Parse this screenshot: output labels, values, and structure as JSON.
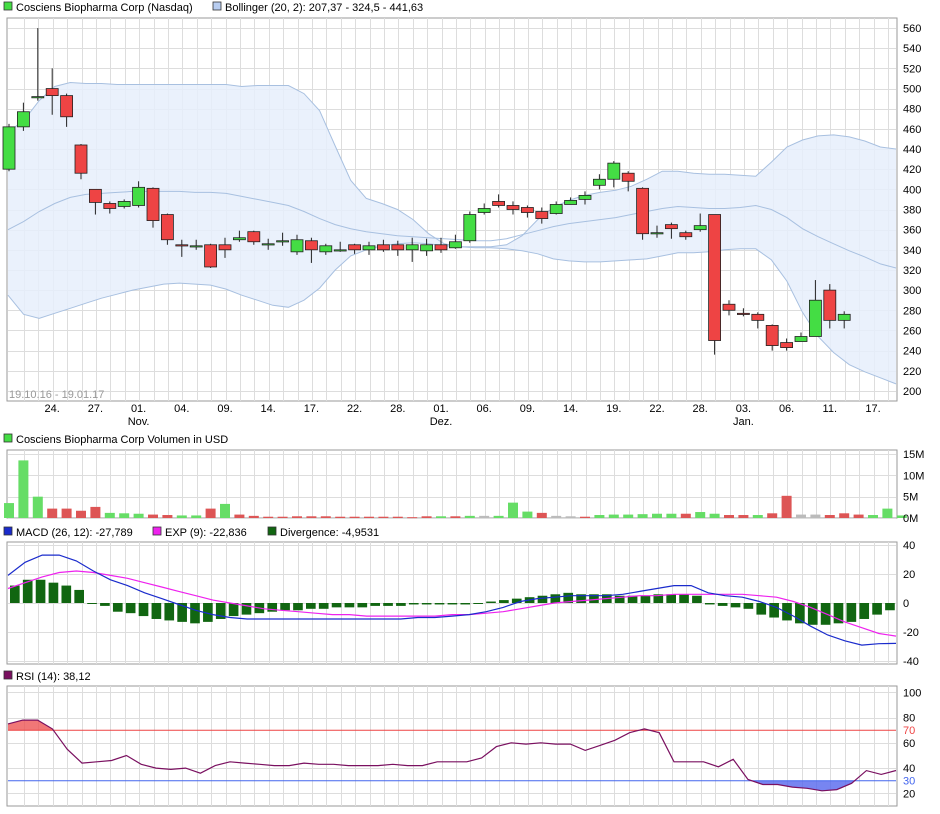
{
  "colors": {
    "up": "#44dd44",
    "down": "#ee4444",
    "band_fill": "#e6eefb",
    "band_line": "#a8c0e0",
    "grid": "#dddddd",
    "macd": "#1a2bcc",
    "signal": "#ee22ee",
    "divergence": "#116611",
    "rsi": "#7a1060",
    "rsi_upper": "#ee4444",
    "rsi_lower": "#4466ee"
  },
  "chart_data": [
    {
      "type": "candlestick",
      "legend": [
        {
          "label": "Cosciens Biopharma Corp (Nasdaq)",
          "swatch": "up"
        },
        {
          "label": "Bollinger (20, 2): 207,37 - 324,5 - 441,63",
          "swatch": "band"
        }
      ],
      "date_range_label": "19.10.16 - 19.01.17",
      "ylim": [
        190,
        570
      ],
      "yticks": [
        200,
        220,
        240,
        260,
        280,
        300,
        320,
        340,
        360,
        380,
        400,
        420,
        440,
        460,
        480,
        500,
        520,
        540,
        560
      ],
      "x_ticks": [
        {
          "i": 3,
          "label": "24."
        },
        {
          "i": 6,
          "label": "27."
        },
        {
          "i": 9,
          "label": "01.",
          "sub": "Nov."
        },
        {
          "i": 12,
          "label": "04."
        },
        {
          "i": 15,
          "label": "09."
        },
        {
          "i": 18,
          "label": "14."
        },
        {
          "i": 21,
          "label": "17."
        },
        {
          "i": 24,
          "label": "22."
        },
        {
          "i": 27,
          "label": "28."
        },
        {
          "i": 30,
          "label": "01.",
          "sub": "Dez."
        },
        {
          "i": 33,
          "label": "06."
        },
        {
          "i": 36,
          "label": "09."
        },
        {
          "i": 39,
          "label": "14."
        },
        {
          "i": 42,
          "label": "19."
        },
        {
          "i": 45,
          "label": "22."
        },
        {
          "i": 48,
          "label": "28."
        },
        {
          "i": 51,
          "label": "03.",
          "sub": "Jan."
        },
        {
          "i": 54,
          "label": "06."
        },
        {
          "i": 57,
          "label": "11."
        },
        {
          "i": 60,
          "label": "17."
        }
      ],
      "candles": [
        [
          420,
          462,
          418,
          465
        ],
        [
          462,
          477,
          458,
          486
        ],
        [
          491,
          492,
          488,
          560
        ],
        [
          500,
          493,
          474,
          520
        ],
        [
          493,
          472,
          462,
          495
        ],
        [
          444,
          416,
          410,
          445
        ],
        [
          400,
          387,
          375,
          400
        ],
        [
          386,
          381,
          376,
          388
        ],
        [
          383,
          388,
          381,
          390
        ],
        [
          384,
          402,
          382,
          408
        ],
        [
          401,
          369,
          362,
          402
        ],
        [
          375,
          350,
          345,
          376
        ],
        [
          345,
          344,
          333,
          350
        ],
        [
          343,
          344,
          340,
          350
        ],
        [
          345,
          323,
          322,
          346
        ],
        [
          345,
          340,
          332,
          352
        ],
        [
          350,
          352,
          348,
          359
        ],
        [
          358,
          348,
          345,
          359
        ],
        [
          345,
          346,
          340,
          351
        ],
        [
          349,
          349,
          344,
          357
        ],
        [
          338,
          350,
          335,
          355
        ],
        [
          349,
          340,
          327,
          352
        ],
        [
          338,
          344,
          335,
          346
        ],
        [
          340,
          340,
          338,
          348
        ],
        [
          345,
          340,
          336,
          346
        ],
        [
          340,
          344,
          335,
          348
        ],
        [
          345,
          340,
          338,
          350
        ],
        [
          345,
          340,
          334,
          349
        ],
        [
          340,
          345,
          328,
          352
        ],
        [
          339,
          345,
          334,
          351
        ],
        [
          345,
          340,
          337,
          352
        ],
        [
          342,
          348,
          341,
          355
        ],
        [
          349,
          375,
          347,
          378
        ],
        [
          377,
          381,
          375,
          386
        ],
        [
          388,
          384,
          382,
          395
        ],
        [
          384,
          380,
          375,
          388
        ],
        [
          382,
          377,
          372,
          384
        ],
        [
          378,
          371,
          366,
          382
        ],
        [
          376,
          385,
          375,
          388
        ],
        [
          385,
          389,
          385,
          392
        ],
        [
          390,
          394,
          385,
          398
        ],
        [
          404,
          410,
          400,
          415
        ],
        [
          410,
          426,
          402,
          428
        ],
        [
          416,
          408,
          398,
          418
        ],
        [
          401,
          356,
          350,
          402
        ],
        [
          357,
          357,
          352,
          364
        ],
        [
          365,
          361,
          351,
          367
        ],
        [
          357,
          353,
          350,
          359
        ],
        [
          360,
          364,
          358,
          376
        ],
        [
          375,
          250,
          236,
          308
        ],
        [
          286,
          280,
          275,
          290
        ],
        [
          277,
          276,
          274,
          282
        ],
        [
          276,
          270,
          262,
          278
        ],
        [
          265,
          245,
          240,
          266
        ],
        [
          248,
          243,
          240,
          252
        ],
        [
          249,
          254,
          249,
          258
        ],
        [
          254,
          290,
          254,
          310
        ],
        [
          300,
          270,
          262,
          306
        ],
        [
          270,
          276,
          262,
          279
        ]
      ],
      "bollinger": {
        "upper": [
          457,
          468,
          488,
          502,
          506,
          505,
          505,
          504,
          504,
          504,
          504,
          504,
          504,
          504,
          504,
          502,
          503,
          503,
          503,
          495,
          478,
          443,
          409,
          391,
          386,
          380,
          370,
          356,
          346,
          343,
          343,
          343,
          345,
          354,
          370,
          382,
          389,
          394,
          397,
          399,
          403,
          410,
          418,
          418,
          416,
          415,
          415,
          414,
          413,
          427,
          442,
          449,
          453,
          454,
          452,
          448,
          442,
          440
        ],
        "middle": [
          360,
          368,
          378,
          386,
          392,
          395,
          396,
          397,
          398,
          398,
          398,
          398,
          397,
          397,
          396,
          393,
          390,
          387,
          384,
          378,
          371,
          365,
          361,
          358,
          356,
          354,
          353,
          352,
          351,
          350,
          349,
          349,
          351,
          355,
          359,
          363,
          366,
          368,
          370,
          372,
          375,
          378,
          381,
          383,
          382,
          381,
          381,
          382,
          384,
          380,
          372,
          361,
          353,
          346,
          339,
          333,
          326,
          322
        ],
        "lower": [
          295,
          276,
          272,
          277,
          282,
          287,
          292,
          296,
          300,
          303,
          306,
          307,
          306,
          305,
          301,
          295,
          290,
          285,
          283,
          290,
          302,
          320,
          334,
          340,
          344,
          346,
          347,
          346,
          344,
          343,
          342,
          342,
          341,
          339,
          336,
          331,
          329,
          328,
          328,
          329,
          330,
          331,
          334,
          337,
          337,
          338,
          340,
          341,
          341,
          330,
          309,
          278,
          254,
          238,
          226,
          219,
          213,
          207
        ]
      }
    },
    {
      "type": "bar",
      "title": "Cosciens Biopharma Corp Volumen in USD",
      "ylim": [
        0,
        15
      ],
      "yticks": [
        {
          "v": 0,
          "label": "0M"
        },
        {
          "v": 5,
          "label": "5M"
        },
        {
          "v": 10,
          "label": "10M"
        },
        {
          "v": 15,
          "label": "15M"
        }
      ],
      "unit": "M",
      "values": [
        3.5,
        13.5,
        5,
        2.2,
        2.2,
        1.7,
        2.6,
        1.2,
        1.1,
        1,
        0.8,
        0.7,
        0.6,
        0.6,
        2.2,
        3.3,
        0.8,
        0.5,
        0.3,
        0.3,
        0.4,
        0.4,
        0.4,
        0.3,
        0.3,
        0.3,
        0.3,
        0.3,
        0.2,
        0.4,
        0.4,
        0.4,
        0.5,
        0.5,
        0.5,
        3.6,
        1.5,
        1.2,
        0.5,
        0.4,
        0.3,
        0.7,
        0.8,
        0.8,
        0.9,
        1,
        1,
        1,
        1.4,
        1,
        0.7,
        0.7,
        0.7,
        1.1,
        5.2,
        0.8,
        0.8,
        0.7,
        1.1,
        0.8,
        0.7,
        2.2,
        0.6
      ],
      "colors": [
        "u",
        "u",
        "u",
        "d",
        "d",
        "d",
        "d",
        "u",
        "u",
        "u",
        "d",
        "d",
        "u",
        "u",
        "d",
        "u",
        "d",
        "d",
        "d",
        "d",
        "d",
        "d",
        "d",
        "d",
        "d",
        "d",
        "d",
        "d",
        "d",
        "d",
        "u",
        "d",
        "u",
        "n",
        "u",
        "u",
        "u",
        "d",
        "n",
        "n",
        "d",
        "u",
        "u",
        "u",
        "u",
        "u",
        "u",
        "d",
        "u",
        "u",
        "d",
        "d",
        "u",
        "d",
        "d",
        "n",
        "n",
        "d",
        "d",
        "d",
        "u",
        "u",
        "u"
      ]
    },
    {
      "type": "line",
      "legend": [
        {
          "label": "MACD (26, 12): -27,789",
          "color": "macd"
        },
        {
          "label": "EXP (9): -22,836",
          "color": "signal"
        },
        {
          "label": "Divergence: -4,9531",
          "color": "divergence"
        }
      ],
      "ylim": [
        -42,
        42
      ],
      "yticks": [
        -40,
        -20,
        0,
        20,
        40
      ],
      "macd": [
        19,
        28,
        33,
        33,
        29,
        22,
        16,
        12,
        7,
        3,
        -1,
        -5,
        -8,
        -10,
        -11,
        -11,
        -11,
        -11,
        -11,
        -11,
        -11,
        -11,
        -11,
        -11,
        -10,
        -10,
        -9,
        -8,
        -6,
        -3,
        1,
        3,
        4,
        5,
        5,
        5,
        6,
        8,
        10,
        12,
        12,
        7,
        5,
        4,
        1,
        -3,
        -9,
        -16,
        -22,
        -26,
        -29,
        -28,
        -27.8
      ],
      "signal": [
        10,
        14,
        18,
        21,
        22,
        21,
        19,
        17,
        14,
        11,
        8,
        5,
        2,
        0,
        -2,
        -4,
        -5,
        -6,
        -7,
        -8,
        -8,
        -9,
        -9,
        -9,
        -9,
        -9,
        -8,
        -8,
        -7,
        -6,
        -4,
        -2,
        0,
        1,
        2,
        3,
        4,
        5,
        5,
        6,
        6,
        6,
        6,
        6,
        5,
        4,
        1,
        -3,
        -8,
        -13,
        -17,
        -21,
        -22.8
      ],
      "divergence": [
        12,
        16,
        16,
        14,
        12,
        9,
        0,
        -2,
        -6,
        -7,
        -9,
        -11,
        -12,
        -13,
        -14,
        -13,
        -11,
        -9,
        -8,
        -7,
        -6,
        -5,
        -5,
        -4,
        -4,
        -3,
        -3,
        -3,
        -2,
        -2,
        -2,
        -1,
        -1,
        -1,
        -1,
        -1,
        0,
        1,
        2,
        3,
        4,
        5,
        6,
        7,
        6,
        6,
        6,
        5,
        5,
        5,
        6,
        6,
        6,
        5,
        -1,
        -2,
        -3,
        -4,
        -8,
        -10,
        -12,
        -14,
        -15,
        -15,
        -14,
        -13,
        -11,
        -8,
        -5
      ]
    },
    {
      "type": "line",
      "legend": [
        {
          "label": "RSI (14): 38,12",
          "color": "rsi"
        }
      ],
      "ylim": [
        10,
        105
      ],
      "yticks": [
        20,
        30,
        40,
        60,
        70,
        80,
        100
      ],
      "highlight_ticks": [
        {
          "v": 70,
          "color": "rsi_upper"
        },
        {
          "v": 30,
          "color": "rsi_lower"
        }
      ],
      "upper": 70,
      "lower": 30,
      "values": [
        75,
        78,
        78,
        71,
        55,
        44,
        45,
        46,
        50,
        43,
        40,
        39,
        40,
        36,
        42,
        45,
        44,
        43,
        42,
        42,
        44,
        43,
        43,
        42,
        42,
        42,
        43,
        42,
        42,
        45,
        45,
        45,
        48,
        57,
        60,
        59,
        60,
        59,
        59,
        54,
        58,
        62,
        68,
        71,
        68,
        45,
        45,
        45,
        41,
        47,
        31,
        27,
        27,
        25,
        24,
        22,
        23,
        28,
        38,
        35,
        38.12
      ]
    }
  ]
}
